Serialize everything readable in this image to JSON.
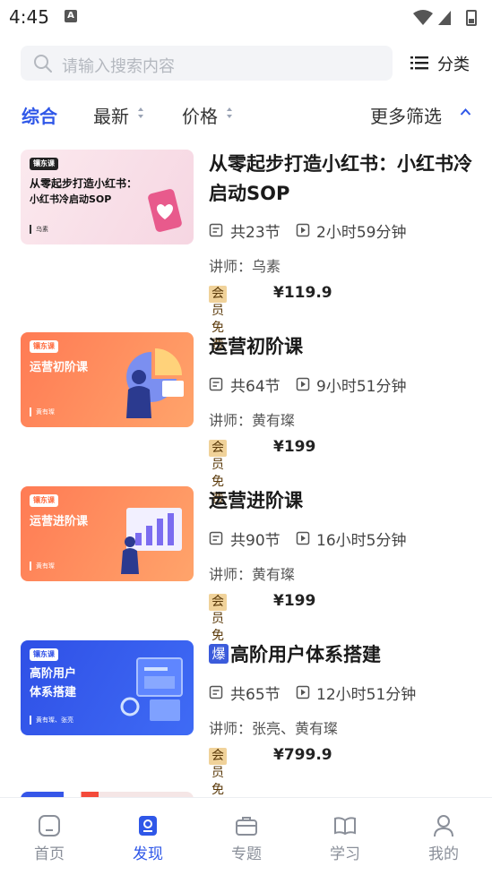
{
  "status": {
    "time": "4:45",
    "a_label": "A"
  },
  "search": {
    "placeholder": "请输入搜索内容",
    "category_label": "分类"
  },
  "filters": {
    "tabs": [
      "综合",
      "最新",
      "价格"
    ],
    "more": "更多筛选"
  },
  "courses": [
    {
      "title": "从零起步打造小红书：小红书冷启动SOP",
      "lessons": "共23节",
      "duration": "2小时59分钟",
      "teacher": "讲师：乌素",
      "vip": "会员免费",
      "price": "¥119.9",
      "hot": false,
      "thumb": {
        "tag": "镶东课",
        "title": "从零起步打造小红书：",
        "subtitle": "小红书冷启动SOP",
        "teacher": "乌素"
      }
    },
    {
      "title": "运营初阶课",
      "lessons": "共64节",
      "duration": "9小时51分钟",
      "teacher": "讲师：黄有璨",
      "vip": "会员免费",
      "price": "¥199",
      "hot": false,
      "thumb": {
        "tag": "镶东课",
        "title": "运营初阶课",
        "teacher": "黄有璨"
      }
    },
    {
      "title": "运营进阶课",
      "lessons": "共90节",
      "duration": "16小时5分钟",
      "teacher": "讲师：黄有璨",
      "vip": "会员免费",
      "price": "¥199",
      "hot": false,
      "thumb": {
        "tag": "镶东课",
        "title": "运营进阶课",
        "teacher": "黄有璨"
      }
    },
    {
      "title": "高阶用户体系搭建",
      "hot_label": "爆",
      "lessons": "共65节",
      "duration": "12小时51分钟",
      "teacher": "讲师：张亮、黄有璨",
      "vip": "会员免费",
      "price": "¥799.9",
      "hot": true,
      "thumb": {
        "tag": "镶东课",
        "title": "高阶用户",
        "subtitle": "体系搭建",
        "teacher": "黄有璨、张亮"
      }
    }
  ],
  "tabbar": [
    {
      "label": "首页",
      "icon": "home-icon"
    },
    {
      "label": "发现",
      "icon": "discover-icon",
      "active": true
    },
    {
      "label": "专题",
      "icon": "topic-icon"
    },
    {
      "label": "学习",
      "icon": "study-icon"
    },
    {
      "label": "我的",
      "icon": "profile-icon"
    }
  ],
  "colors": {
    "accent": "#2f57e8",
    "vip_bg": "#f0d29a",
    "search_bg": "#f3f4f7"
  }
}
